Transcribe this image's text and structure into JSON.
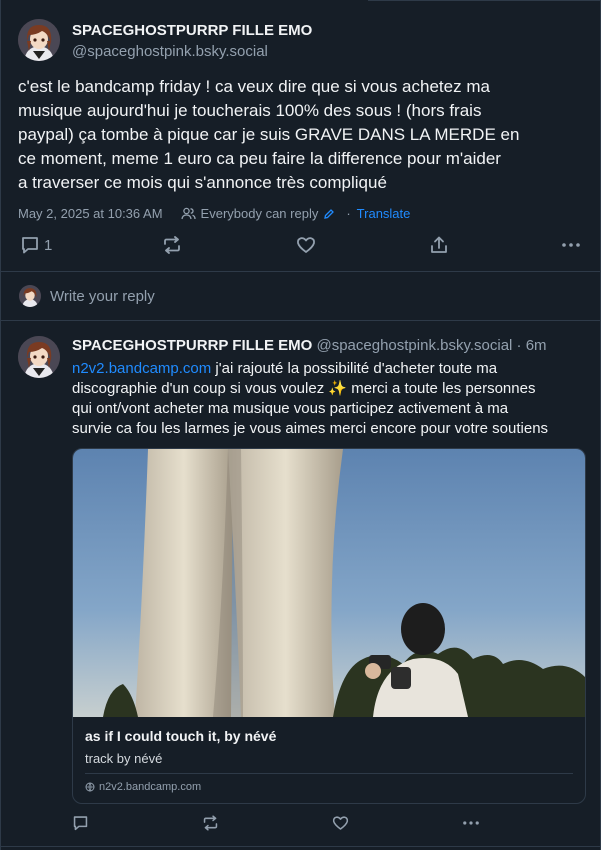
{
  "main_post": {
    "display_name": "SPACEGHOSTPURRP FILLE EMO",
    "handle": "@spaceghostpink.bsky.social",
    "text_lines": [
      "c'est le bandcamp friday ! ca veux dire que si vous achetez ma",
      "musique aujourd'hui je toucherais 100% des sous ! (hors frais",
      "paypal) ça tombe à pique car je suis GRAVE DANS LA MERDE en",
      "ce moment, meme 1 euro ca peu faire la difference pour m'aider",
      "a traverser ce mois qui s'annonce très compliqué"
    ],
    "timestamp": "May 2, 2025 at 10:36 AM",
    "audience": "Everybody can reply",
    "separator": "·",
    "translate_label": "Translate",
    "reply_count": "1",
    "icons": [
      "reply-icon",
      "repost-icon",
      "like-icon",
      "share-icon",
      "more-icon"
    ]
  },
  "reply_box": {
    "placeholder": "Write your reply"
  },
  "reply_post": {
    "display_name": "SPACEGHOSTPURRP FILLE EMO",
    "handle": "@spaceghostpink.bsky.social",
    "separator": " · ",
    "age": "6m",
    "link_text": "n2v2.bandcamp.com",
    "text_after_link": " j'ai rajouté la possibilité d'acheter toute ma",
    "text_lines": [
      "discographie d'un coup si vous voulez ✨ merci a toute les personnes",
      "qui ont/vont acheter ma musique vous participez activement à ma",
      "survie ca fou les larmes je vous aimes merci encore pour votre soutiens"
    ],
    "embed": {
      "title": "as if I could touch it, by névé",
      "description": "track by névé",
      "domain": "n2v2.bandcamp.com"
    }
  },
  "colors": {
    "background": "#161e27",
    "border": "#2e3a48",
    "text": "#f1f3f5",
    "muted": "#93a0ae",
    "link": "#208bfe"
  }
}
